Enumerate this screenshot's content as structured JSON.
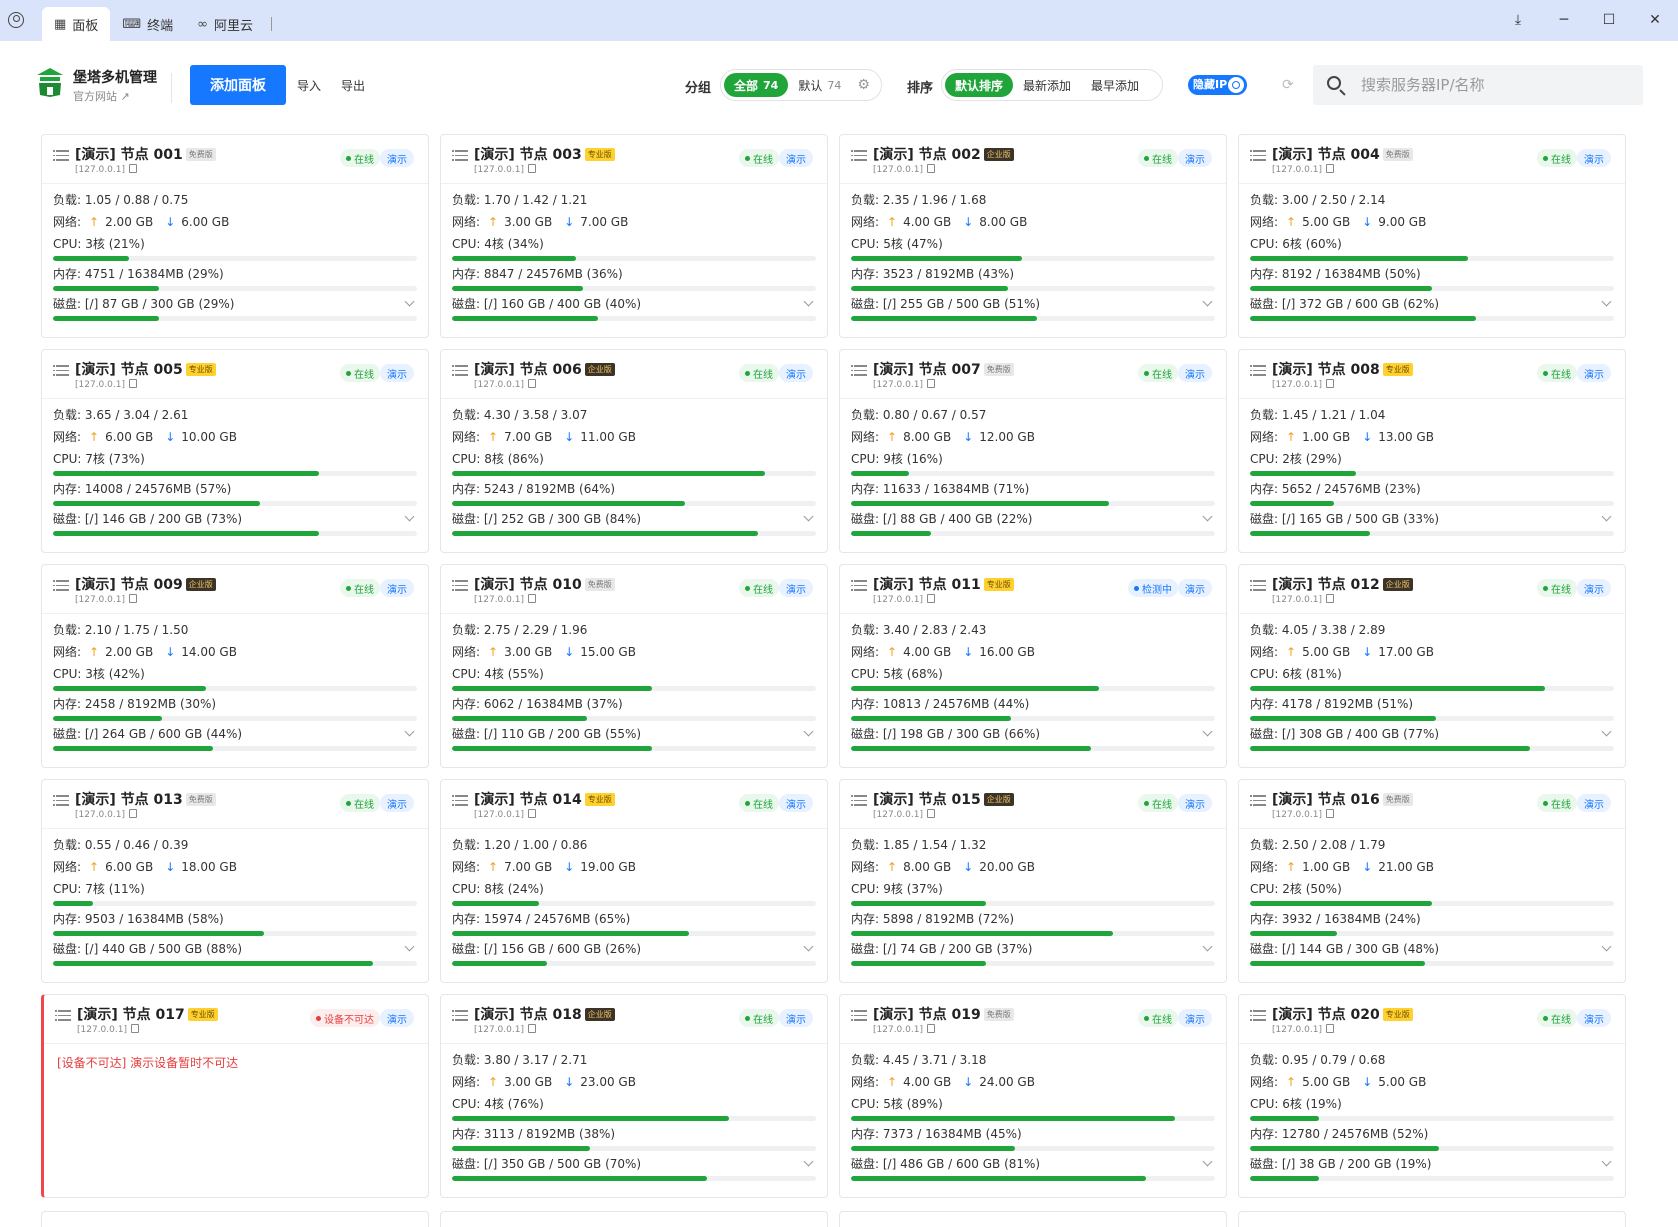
{
  "titlebar": {
    "tabs": [
      {
        "label": "面板",
        "icon": "grid-icon"
      },
      {
        "label": "终端",
        "icon": "terminal-icon"
      },
      {
        "label": "阿里云",
        "icon": "link-icon"
      }
    ]
  },
  "header": {
    "brand_title": "堡塔多机管理",
    "brand_link": "官方网站 ↗",
    "add_panel": "添加面板",
    "import": "导入",
    "export": "导出",
    "group_label": "分组",
    "groups": [
      {
        "label": "全部",
        "count": "74",
        "active": true
      },
      {
        "label": "默认",
        "count": "74",
        "active": false
      }
    ],
    "sort_label": "排序",
    "sorts": [
      {
        "label": "默认排序",
        "active": true
      },
      {
        "label": "最新添加",
        "active": false
      },
      {
        "label": "最早添加",
        "active": false
      }
    ],
    "hide_ip": "隐藏IP",
    "search_placeholder": "搜索服务器IP/名称"
  },
  "colors": {
    "accent": "#20a53a",
    "primary": "#1677ff",
    "error": "#e53e3e"
  },
  "labels": {
    "load": "负载:",
    "net": "网络:",
    "cpu": "CPU:",
    "mem": "内存:",
    "disk": "磁盘:",
    "demo": "演示"
  },
  "nodes": [
    {
      "name": "[演示] 节点 001",
      "edition": "免费版",
      "ed": "free",
      "ip": "[127.0.0.1]",
      "status": "在线",
      "st": "online",
      "load": "1.05 / 0.88 / 0.75",
      "up": "2.00 GB",
      "down": "6.00 GB",
      "cpu": "3核 (21%)",
      "cpu_pct": 21,
      "mem": "4751 / 16384MB (29%)",
      "mem_pct": 29,
      "disk": "[/] 87 GB / 300 GB (29%)",
      "disk_pct": 29
    },
    {
      "name": "[演示] 节点 003",
      "edition": "专业版",
      "ed": "pro",
      "ip": "[127.0.0.1]",
      "status": "在线",
      "st": "online",
      "load": "1.70 / 1.42 / 1.21",
      "up": "3.00 GB",
      "down": "7.00 GB",
      "cpu": "4核 (34%)",
      "cpu_pct": 34,
      "mem": "8847 / 24576MB (36%)",
      "mem_pct": 36,
      "disk": "[/] 160 GB / 400 GB (40%)",
      "disk_pct": 40
    },
    {
      "name": "[演示] 节点 002",
      "edition": "企业版",
      "ed": "ent",
      "ip": "[127.0.0.1]",
      "status": "在线",
      "st": "online",
      "load": "2.35 / 1.96 / 1.68",
      "up": "4.00 GB",
      "down": "8.00 GB",
      "cpu": "5核 (47%)",
      "cpu_pct": 47,
      "mem": "3523 / 8192MB (43%)",
      "mem_pct": 43,
      "disk": "[/] 255 GB / 500 GB (51%)",
      "disk_pct": 51
    },
    {
      "name": "[演示] 节点 004",
      "edition": "免费版",
      "ed": "free",
      "ip": "[127.0.0.1]",
      "status": "在线",
      "st": "online",
      "load": "3.00 / 2.50 / 2.14",
      "up": "5.00 GB",
      "down": "9.00 GB",
      "cpu": "6核 (60%)",
      "cpu_pct": 60,
      "mem": "8192 / 16384MB (50%)",
      "mem_pct": 50,
      "disk": "[/] 372 GB / 600 GB (62%)",
      "disk_pct": 62
    },
    {
      "name": "[演示] 节点 005",
      "edition": "专业版",
      "ed": "pro",
      "ip": "[127.0.0.1]",
      "status": "在线",
      "st": "online",
      "load": "3.65 / 3.04 / 2.61",
      "up": "6.00 GB",
      "down": "10.00 GB",
      "cpu": "7核 (73%)",
      "cpu_pct": 73,
      "mem": "14008 / 24576MB (57%)",
      "mem_pct": 57,
      "disk": "[/] 146 GB / 200 GB (73%)",
      "disk_pct": 73
    },
    {
      "name": "[演示] 节点 006",
      "edition": "企业版",
      "ed": "ent",
      "ip": "[127.0.0.1]",
      "status": "在线",
      "st": "online",
      "load": "4.30 / 3.58 / 3.07",
      "up": "7.00 GB",
      "down": "11.00 GB",
      "cpu": "8核 (86%)",
      "cpu_pct": 86,
      "mem": "5243 / 8192MB (64%)",
      "mem_pct": 64,
      "disk": "[/] 252 GB / 300 GB (84%)",
      "disk_pct": 84
    },
    {
      "name": "[演示] 节点 007",
      "edition": "免费版",
      "ed": "free",
      "ip": "[127.0.0.1]",
      "status": "在线",
      "st": "online",
      "load": "0.80 / 0.67 / 0.57",
      "up": "8.00 GB",
      "down": "12.00 GB",
      "cpu": "9核 (16%)",
      "cpu_pct": 16,
      "mem": "11633 / 16384MB (71%)",
      "mem_pct": 71,
      "disk": "[/] 88 GB / 400 GB (22%)",
      "disk_pct": 22
    },
    {
      "name": "[演示] 节点 008",
      "edition": "专业版",
      "ed": "pro",
      "ip": "[127.0.0.1]",
      "status": "在线",
      "st": "online",
      "load": "1.45 / 1.21 / 1.04",
      "up": "1.00 GB",
      "down": "13.00 GB",
      "cpu": "2核 (29%)",
      "cpu_pct": 29,
      "mem": "5652 / 24576MB (23%)",
      "mem_pct": 23,
      "disk": "[/] 165 GB / 500 GB (33%)",
      "disk_pct": 33
    },
    {
      "name": "[演示] 节点 009",
      "edition": "企业版",
      "ed": "ent",
      "ip": "[127.0.0.1]",
      "status": "在线",
      "st": "online",
      "load": "2.10 / 1.75 / 1.50",
      "up": "2.00 GB",
      "down": "14.00 GB",
      "cpu": "3核 (42%)",
      "cpu_pct": 42,
      "mem": "2458 / 8192MB (30%)",
      "mem_pct": 30,
      "disk": "[/] 264 GB / 600 GB (44%)",
      "disk_pct": 44
    },
    {
      "name": "[演示] 节点 010",
      "edition": "免费版",
      "ed": "free",
      "ip": "[127.0.0.1]",
      "status": "在线",
      "st": "online",
      "load": "2.75 / 2.29 / 1.96",
      "up": "3.00 GB",
      "down": "15.00 GB",
      "cpu": "4核 (55%)",
      "cpu_pct": 55,
      "mem": "6062 / 16384MB (37%)",
      "mem_pct": 37,
      "disk": "[/] 110 GB / 200 GB (55%)",
      "disk_pct": 55
    },
    {
      "name": "[演示] 节点 011",
      "edition": "专业版",
      "ed": "pro",
      "ip": "[127.0.0.1]",
      "status": "检测中",
      "st": "checking",
      "load": "3.40 / 2.83 / 2.43",
      "up": "4.00 GB",
      "down": "16.00 GB",
      "cpu": "5核 (68%)",
      "cpu_pct": 68,
      "mem": "10813 / 24576MB (44%)",
      "mem_pct": 44,
      "disk": "[/] 198 GB / 300 GB (66%)",
      "disk_pct": 66
    },
    {
      "name": "[演示] 节点 012",
      "edition": "企业版",
      "ed": "ent",
      "ip": "[127.0.0.1]",
      "status": "在线",
      "st": "online",
      "load": "4.05 / 3.38 / 2.89",
      "up": "5.00 GB",
      "down": "17.00 GB",
      "cpu": "6核 (81%)",
      "cpu_pct": 81,
      "mem": "4178 / 8192MB (51%)",
      "mem_pct": 51,
      "disk": "[/] 308 GB / 400 GB (77%)",
      "disk_pct": 77
    },
    {
      "name": "[演示] 节点 013",
      "edition": "免费版",
      "ed": "free",
      "ip": "[127.0.0.1]",
      "status": "在线",
      "st": "online",
      "load": "0.55 / 0.46 / 0.39",
      "up": "6.00 GB",
      "down": "18.00 GB",
      "cpu": "7核 (11%)",
      "cpu_pct": 11,
      "mem": "9503 / 16384MB (58%)",
      "mem_pct": 58,
      "disk": "[/] 440 GB / 500 GB (88%)",
      "disk_pct": 88
    },
    {
      "name": "[演示] 节点 014",
      "edition": "专业版",
      "ed": "pro",
      "ip": "[127.0.0.1]",
      "status": "在线",
      "st": "online",
      "load": "1.20 / 1.00 / 0.86",
      "up": "7.00 GB",
      "down": "19.00 GB",
      "cpu": "8核 (24%)",
      "cpu_pct": 24,
      "mem": "15974 / 24576MB (65%)",
      "mem_pct": 65,
      "disk": "[/] 156 GB / 600 GB (26%)",
      "disk_pct": 26
    },
    {
      "name": "[演示] 节点 015",
      "edition": "企业版",
      "ed": "ent",
      "ip": "[127.0.0.1]",
      "status": "在线",
      "st": "online",
      "load": "1.85 / 1.54 / 1.32",
      "up": "8.00 GB",
      "down": "20.00 GB",
      "cpu": "9核 (37%)",
      "cpu_pct": 37,
      "mem": "5898 / 8192MB (72%)",
      "mem_pct": 72,
      "disk": "[/] 74 GB / 200 GB (37%)",
      "disk_pct": 37
    },
    {
      "name": "[演示] 节点 016",
      "edition": "免费版",
      "ed": "free",
      "ip": "[127.0.0.1]",
      "status": "在线",
      "st": "online",
      "load": "2.50 / 2.08 / 1.79",
      "up": "1.00 GB",
      "down": "21.00 GB",
      "cpu": "2核 (50%)",
      "cpu_pct": 50,
      "mem": "3932 / 16384MB (24%)",
      "mem_pct": 24,
      "disk": "[/] 144 GB / 300 GB (48%)",
      "disk_pct": 48
    },
    {
      "name": "[演示] 节点 017",
      "edition": "专业版",
      "ed": "pro",
      "ip": "[127.0.0.1]",
      "status": "设备不可达",
      "st": "offline",
      "error": "[设备不可达] 演示设备暂时不可达"
    },
    {
      "name": "[演示] 节点 018",
      "edition": "企业版",
      "ed": "ent",
      "ip": "[127.0.0.1]",
      "status": "在线",
      "st": "online",
      "load": "3.80 / 3.17 / 2.71",
      "up": "3.00 GB",
      "down": "23.00 GB",
      "cpu": "4核 (76%)",
      "cpu_pct": 76,
      "mem": "3113 / 8192MB (38%)",
      "mem_pct": 38,
      "disk": "[/] 350 GB / 500 GB (70%)",
      "disk_pct": 70
    },
    {
      "name": "[演示] 节点 019",
      "edition": "免费版",
      "ed": "free",
      "ip": "[127.0.0.1]",
      "status": "在线",
      "st": "online",
      "load": "4.45 / 3.71 / 3.18",
      "up": "4.00 GB",
      "down": "24.00 GB",
      "cpu": "5核 (89%)",
      "cpu_pct": 89,
      "mem": "7373 / 16384MB (45%)",
      "mem_pct": 45,
      "disk": "[/] 486 GB / 600 GB (81%)",
      "disk_pct": 81
    },
    {
      "name": "[演示] 节点 020",
      "edition": "专业版",
      "ed": "pro",
      "ip": "[127.0.0.1]",
      "status": "在线",
      "st": "online",
      "load": "0.95 / 0.79 / 0.68",
      "up": "5.00 GB",
      "down": "5.00 GB",
      "cpu": "6核 (19%)",
      "cpu_pct": 19,
      "mem": "12780 / 24576MB (52%)",
      "mem_pct": 52,
      "disk": "[/] 38 GB / 200 GB (19%)",
      "disk_pct": 19
    }
  ]
}
